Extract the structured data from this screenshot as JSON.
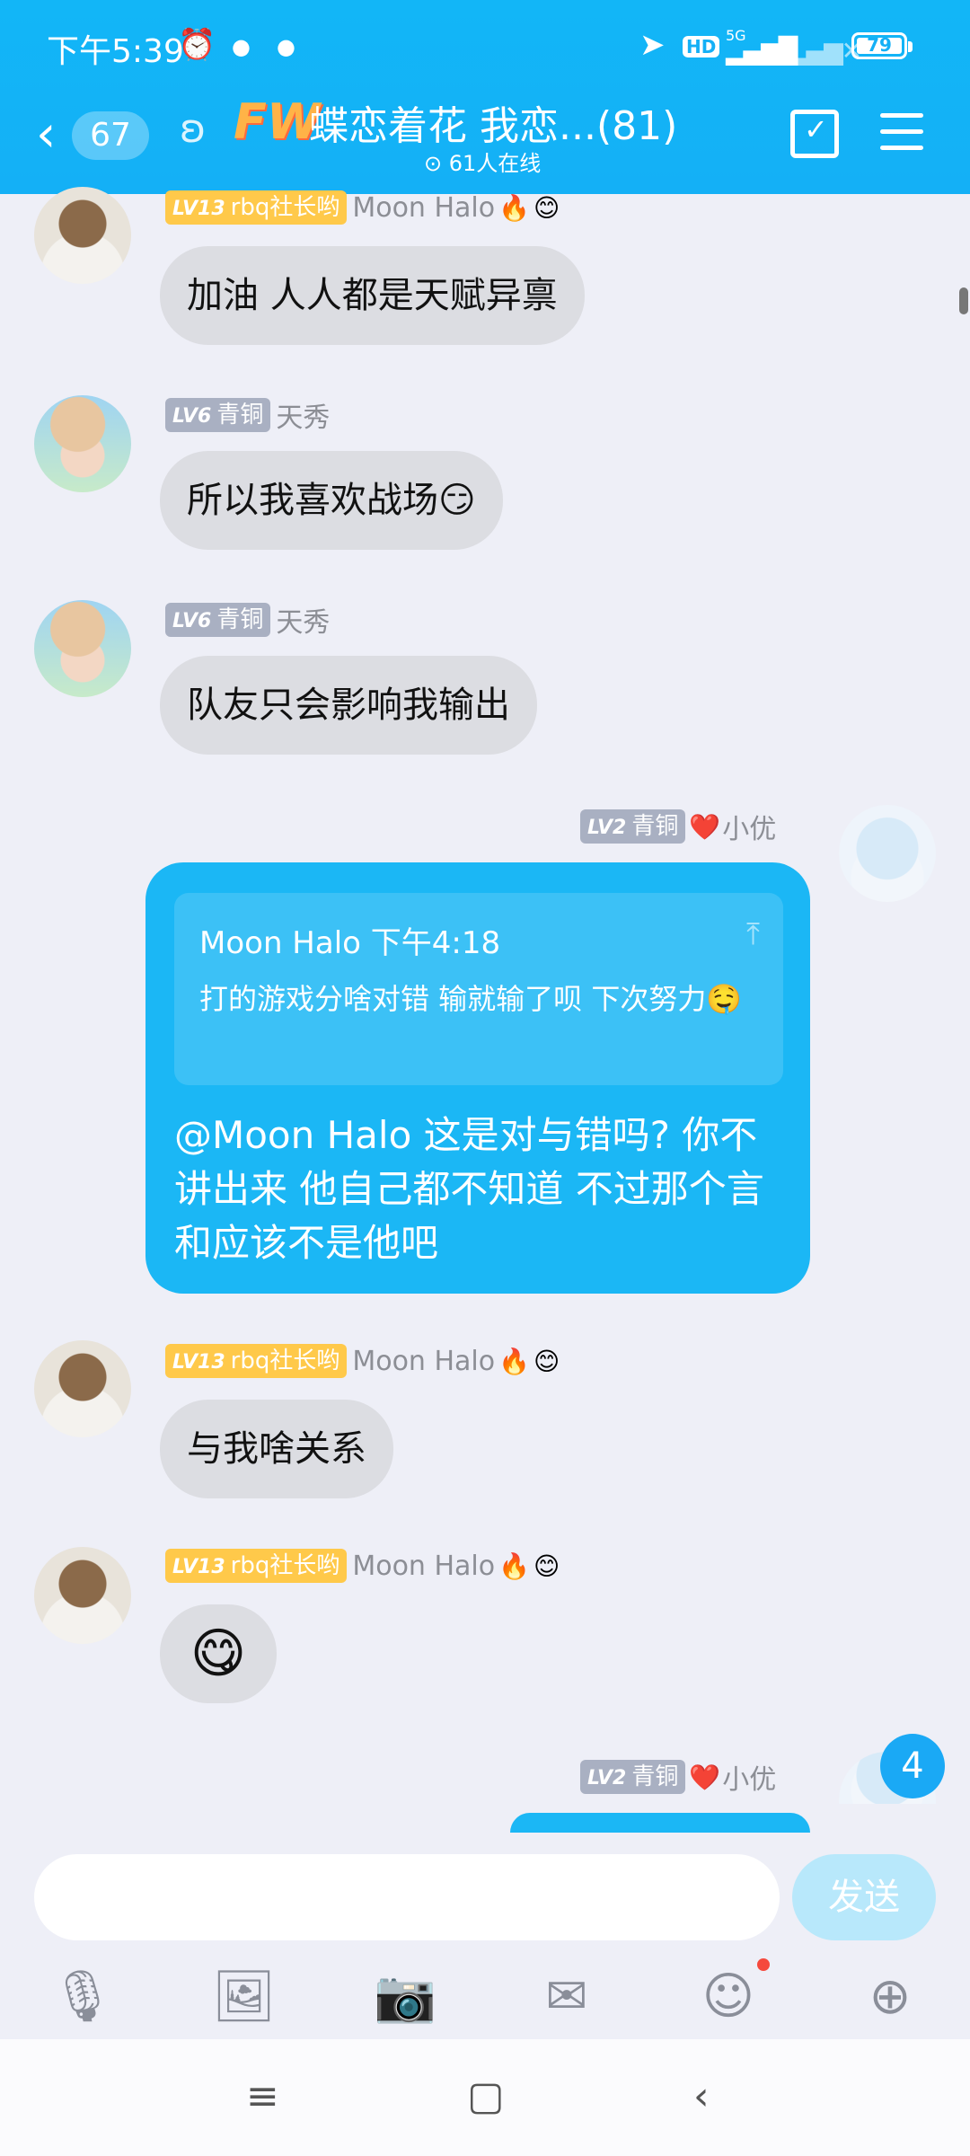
{
  "status_bar": {
    "time": "下午5:39",
    "battery": "79",
    "network": "5G",
    "hd": "HD"
  },
  "header": {
    "back_count": "67",
    "group_prefix": "FW",
    "title": "蝶恋着花 我恋...(81)",
    "online": "61人在线"
  },
  "messages": [
    {
      "badge_lv": "LV13",
      "badge_title": "rbq社长哟",
      "sender": "Moon Halo",
      "text": "加油 人人都是天赋异禀"
    },
    {
      "badge_lv": "LV6",
      "badge_title": "青铜",
      "sender": "天秀",
      "text": "所以我喜欢战场😏"
    },
    {
      "badge_lv": "LV6",
      "badge_title": "青铜",
      "sender": "天秀",
      "text": "队友只会影响我输出"
    },
    {
      "badge_lv": "LV2",
      "badge_title": "青铜",
      "sender": "小优",
      "quote_header": "Moon Halo 下午4:18",
      "quote_text": "打的游戏分啥对错 输就输了呗 下次努力🤤",
      "text": "@Moon Halo 这是对与错吗? 你不讲出来 他自己都不知道 不过那个言和应该不是他吧"
    },
    {
      "badge_lv": "LV13",
      "badge_title": "rbq社长哟",
      "sender": "Moon Halo",
      "text": "与我啥关系"
    },
    {
      "badge_lv": "LV13",
      "badge_title": "rbq社长哟",
      "sender": "Moon Halo",
      "text": "😋"
    },
    {
      "badge_lv": "LV2",
      "badge_title": "青铜",
      "sender": "小优"
    }
  ],
  "new_message_count": "4",
  "input": {
    "placeholder": "",
    "send_label": "发送"
  },
  "toolbar": [
    "mic-icon",
    "image-icon",
    "camera-icon",
    "red-packet-icon",
    "emoji-icon",
    "plus-icon"
  ]
}
